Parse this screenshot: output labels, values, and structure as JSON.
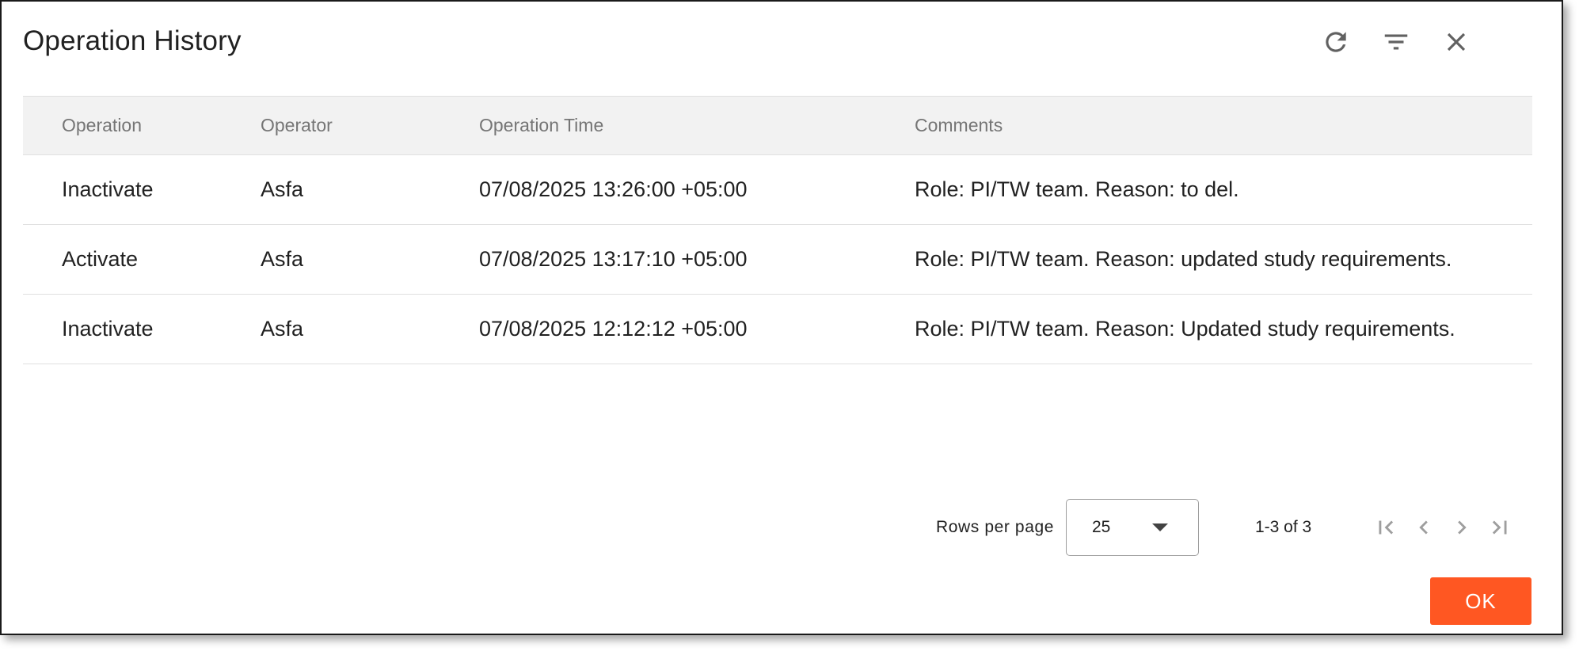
{
  "dialog": {
    "title": "Operation History",
    "header_icons": [
      "refresh-icon",
      "filter-icon",
      "close-icon"
    ]
  },
  "table": {
    "columns": [
      "Operation",
      "Operator",
      "Operation Time",
      "Comments"
    ],
    "rows": [
      {
        "operation": "Inactivate",
        "operator": "Asfa",
        "time": "07/08/2025 13:26:00 +05:00",
        "comments": "Role: PI/TW team. Reason: to del."
      },
      {
        "operation": "Activate",
        "operator": "Asfa",
        "time": "07/08/2025 13:17:10 +05:00",
        "comments": "Role: PI/TW team. Reason: updated study requirements."
      },
      {
        "operation": "Inactivate",
        "operator": "Asfa",
        "time": "07/08/2025 12:12:12 +05:00",
        "comments": "Role: PI/TW team. Reason: Updated study requirements."
      }
    ]
  },
  "pagination": {
    "rows_per_page_label": "Rows per page",
    "rows_per_page_value": "25",
    "range_label": "1-3 of 3",
    "icons": [
      "first-page-icon",
      "previous-page-icon",
      "next-page-icon",
      "last-page-icon"
    ]
  },
  "footer": {
    "ok_label": "OK"
  },
  "colors": {
    "accent": "#ff5722",
    "header_bg": "#f2f2f2",
    "divider": "#e0e0e0",
    "icon": "#616161"
  }
}
